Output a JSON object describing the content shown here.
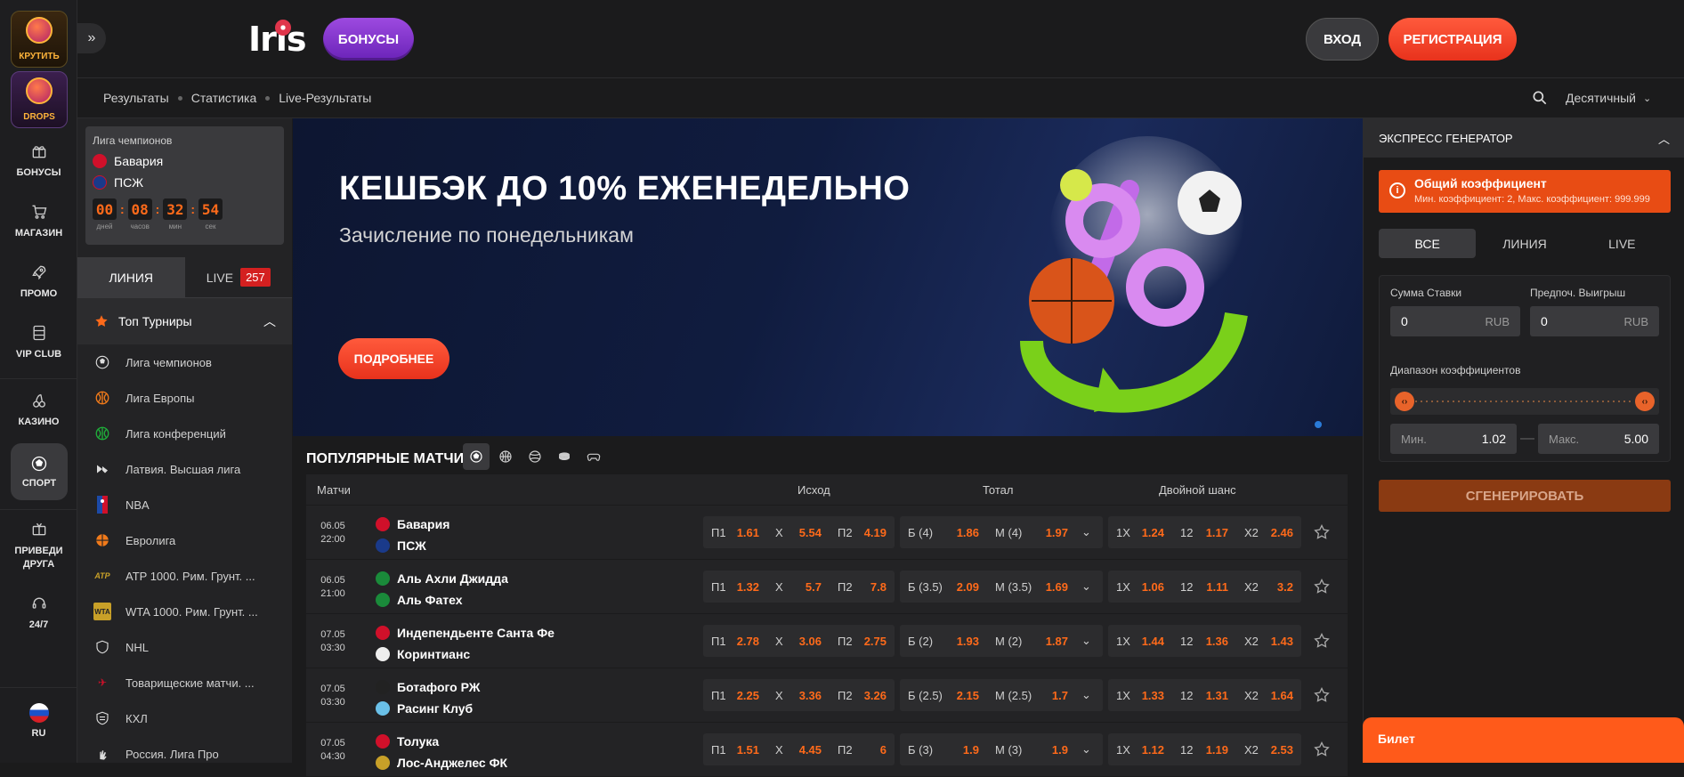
{
  "rail": {
    "spin_label": "КРУТИТЬ",
    "drops_label": "DROPS",
    "items": [
      {
        "label": "БОНУСЫ",
        "icon": "gift-icon"
      },
      {
        "label": "МАГАЗИН",
        "icon": "cart-icon"
      },
      {
        "label": "ПРОМО",
        "icon": "rocket-icon"
      },
      {
        "label": "VIP CLUB",
        "icon": "vip-icon"
      },
      {
        "label": "КАЗИНО",
        "icon": "cherry-icon"
      },
      {
        "label": "СПОРТ",
        "icon": "soccer-ball-icon"
      },
      {
        "label": "ПРИВЕДИ ДРУГА",
        "icon": "gift-friend-icon"
      },
      {
        "label": "24/7",
        "icon": "headset-icon"
      }
    ],
    "language": "RU"
  },
  "header": {
    "logo": "Iris",
    "bonus_button": "БОНУСЫ",
    "login_button": "ВХОД",
    "register_button": "РЕГИСТРАЦИЯ"
  },
  "subnav": {
    "crumbs": [
      "Результаты",
      "Статистика",
      "Live-Результаты"
    ],
    "odds_format": "Десятичный"
  },
  "sidebar": {
    "match_card": {
      "league": "Лига чемпионов",
      "team1": "Бавария",
      "team2": "ПСЖ",
      "countdown": [
        {
          "value": "00",
          "label": "дней"
        },
        {
          "value": "08",
          "label": "часов"
        },
        {
          "value": "32",
          "label": "мин"
        },
        {
          "value": "54",
          "label": "сек"
        }
      ]
    },
    "tab_line": "ЛИНИЯ",
    "tab_live": "LIVE",
    "live_count": "257",
    "top_header": "Топ Турниры",
    "tournaments": [
      "Лига чемпионов",
      "Лига Европы",
      "Лига конференций",
      "Латвия. Высшая лига",
      "NBA",
      "Евролига",
      "ATP 1000. Рим. Грунт. ...",
      "WTA 1000. Рим. Грунт. ...",
      "NHL",
      "Товарищеские матчи. ...",
      "КХЛ",
      "Россия. Лига Про"
    ]
  },
  "banner": {
    "title": "КЕШБЭК ДО 10% ЕЖЕНЕДЕЛЬНО",
    "subtitle": "Зачисление по понедельникам",
    "button": "ПОДРОБНЕЕ"
  },
  "popular": {
    "title": "ПОПУЛЯРНЫЕ МАТЧИ",
    "columns": {
      "matches": "Матчи",
      "outcome": "Исход",
      "total": "Тотал",
      "double": "Двойной шанс"
    },
    "rows": [
      {
        "date": "06.05",
        "time": "22:00",
        "team1": "Бавария",
        "team2": "ПСЖ",
        "p1": "1.61",
        "x": "5.54",
        "p2": "4.19",
        "over_k": "Б (4)",
        "over": "1.86",
        "under_k": "М (4)",
        "under": "1.97",
        "d1x": "1.24",
        "d12": "1.17",
        "dx2": "2.46"
      },
      {
        "date": "06.05",
        "time": "21:00",
        "team1": "Аль Ахли Джидда",
        "team2": "Аль Фатех",
        "p1": "1.32",
        "x": "5.7",
        "p2": "7.8",
        "over_k": "Б (3.5)",
        "over": "2.09",
        "under_k": "М (3.5)",
        "under": "1.69",
        "d1x": "1.06",
        "d12": "1.11",
        "dx2": "3.2"
      },
      {
        "date": "07.05",
        "time": "03:30",
        "team1": "Индепендьенте Санта Фе",
        "team2": "Коринтианс",
        "p1": "2.78",
        "x": "3.06",
        "p2": "2.75",
        "over_k": "Б (2)",
        "over": "1.93",
        "under_k": "М (2)",
        "under": "1.87",
        "d1x": "1.44",
        "d12": "1.36",
        "dx2": "1.43"
      },
      {
        "date": "07.05",
        "time": "03:30",
        "team1": "Ботафого РЖ",
        "team2": "Расинг Клуб",
        "p1": "2.25",
        "x": "3.36",
        "p2": "3.26",
        "over_k": "Б (2.5)",
        "over": "2.15",
        "under_k": "М (2.5)",
        "under": "1.7",
        "d1x": "1.33",
        "d12": "1.31",
        "dx2": "1.64"
      },
      {
        "date": "07.05",
        "time": "04:30",
        "team1": "Толука",
        "team2": "Лос-Анджелес ФК",
        "p1": "1.51",
        "x": "4.45",
        "p2": "6",
        "over_k": "Б (3)",
        "over": "1.9",
        "under_k": "М (3)",
        "under": "1.9",
        "d1x": "1.12",
        "d12": "1.19",
        "dx2": "2.53"
      }
    ],
    "labels": {
      "p1": "П1",
      "x": "Х",
      "p2": "П2",
      "d1x": "1Х",
      "d12": "12",
      "dx2": "Х2"
    }
  },
  "express": {
    "title": "ЭКСПРЕСС ГЕНЕРАТОР",
    "coef_title": "Общий коэффициент",
    "coef_sub": "Мин. коэффициент: 2, Макс. коэффициент: 999.999",
    "tabs": [
      "ВСЕ",
      "ЛИНИЯ",
      "LIVE"
    ],
    "stake_label": "Сумма Ставки",
    "stake_value": "0",
    "win_label": "Предпоч. Выигрыш",
    "win_value": "0",
    "currency": "RUB",
    "range_label": "Диапазон коэффициентов",
    "min_label": "Мин.",
    "min_value": "1.02",
    "max_label": "Макс.",
    "max_value": "5.00",
    "generate": "СГЕНЕРИРОВАТЬ"
  },
  "ticket": {
    "label": "Билет"
  },
  "colors": {
    "accent": "#ff6a1a",
    "brand_purple": "#8a3ad0",
    "live_red": "#d42020"
  }
}
